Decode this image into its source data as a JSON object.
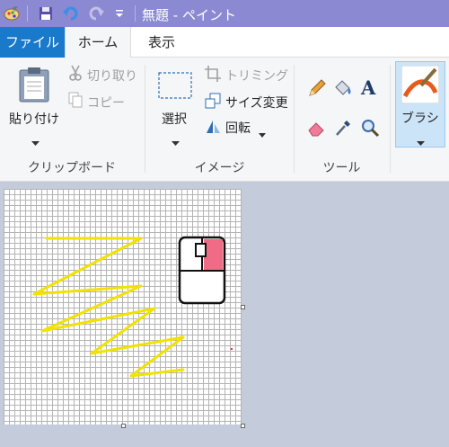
{
  "window": {
    "title": "無題 - ペイント"
  },
  "tabs": {
    "file": "ファイル",
    "home": "ホーム",
    "view": "表示"
  },
  "clipboard": {
    "paste": "貼り付け",
    "cut": "切り取り",
    "copy": "コピー",
    "group": "クリップボード"
  },
  "image": {
    "select": "選択",
    "crop": "トリミング",
    "resize": "サイズ変更",
    "rotate": "回転",
    "group": "イメージ"
  },
  "tools": {
    "group": "ツール"
  },
  "brushes": {
    "label": "ブラシ"
  },
  "colors": {
    "accent": "#1979ca",
    "titlebar": "#8b89d2",
    "stroke": "#f2e200",
    "mouse_button": "#f06b85"
  }
}
